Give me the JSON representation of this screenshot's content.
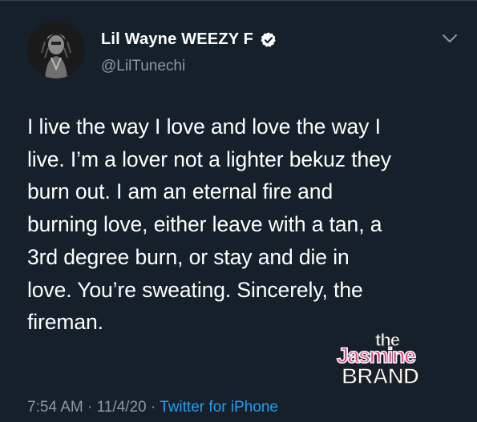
{
  "tweet": {
    "author_name": "Lil Wayne WEEZY F",
    "handle": "@LilTunechi",
    "verified_icon": "verified-badge-icon",
    "menu_icon": "chevron-down-icon",
    "lines": [
      "I live the way I love and love the way I",
      "live. I’m a lover not a lighter bekuz they",
      "burn out. I am an eternal fire and",
      "burning love, either leave with a tan, a",
      "3rd degree burn, or stay and die in",
      "love. You’re sweating.  Sincerely, the",
      "fireman."
    ],
    "time": "7:54 AM",
    "separator": "·",
    "date": "11/4/20",
    "source": "Twitter for iPhone"
  },
  "watermark": {
    "the": "the",
    "jasmine": "Jasmine",
    "brand": "BRAND"
  },
  "colors": {
    "background": "#15202b",
    "secondary_text": "#8899a6",
    "accent": "#1da1f2",
    "watermark_pink": "#e8478b"
  }
}
